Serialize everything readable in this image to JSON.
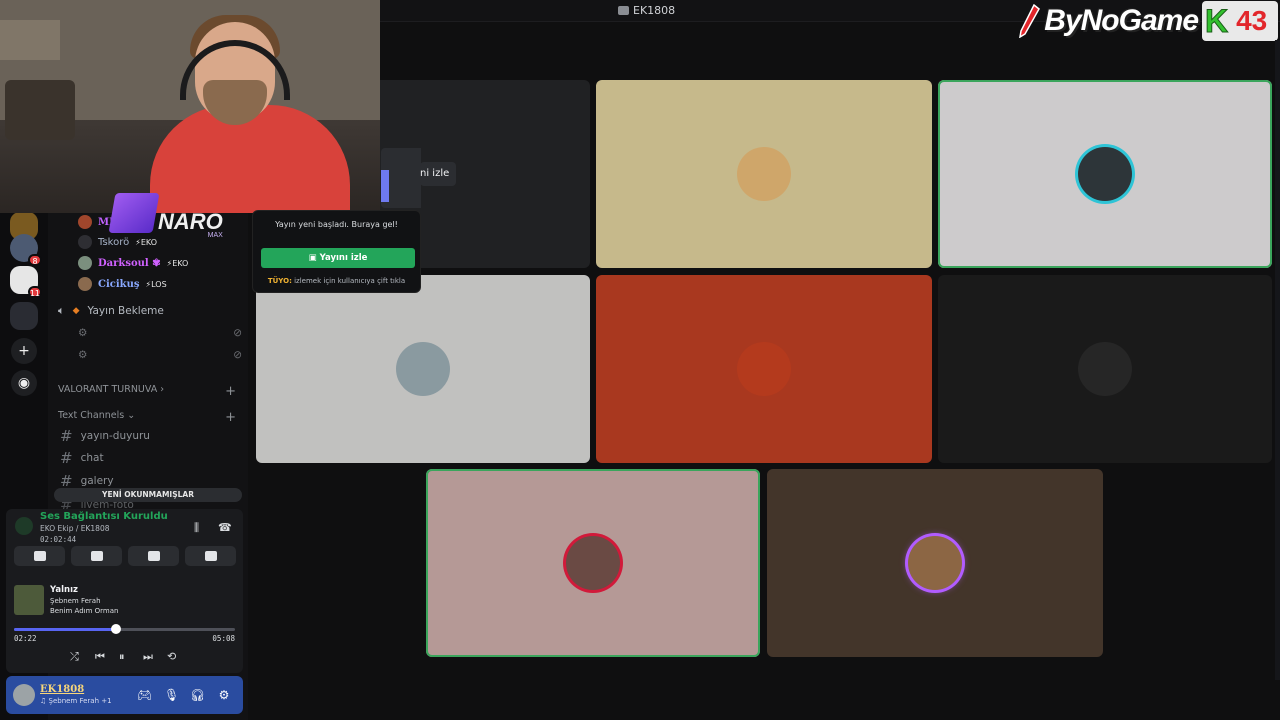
{
  "window": {
    "title": "EK1808"
  },
  "logo": {
    "brand": "ByNoGame",
    "k_letter": "K",
    "number": "43"
  },
  "watermark": {
    "text": "NARO",
    "sub": "MAX"
  },
  "rail": {
    "badges": [
      "8",
      "11"
    ]
  },
  "sidebar": {
    "members": [
      {
        "name": "MIN",
        "tag": "",
        "color": "#c061ff"
      },
      {
        "name": "Tskorö",
        "tag": "⚡EKO",
        "color": "#a7b3c8"
      },
      {
        "name": "Darksoul ✾",
        "tag": "⚡EKO",
        "color": "#d061ff"
      },
      {
        "name": "Cicikuş",
        "tag": "⚡LOS",
        "color": "#89a8ff"
      }
    ],
    "voice_channel": "Yayın Bekleme",
    "category_valorant": "VALORANT TURNUVA",
    "category_text": "Text Channels",
    "text_channels": [
      "yayın-duyuru",
      "chat",
      "galery",
      "livem-foto"
    ],
    "unread_banner": "YENİ OKUNMAMIŞLAR"
  },
  "voice_panel": {
    "status": "Ses Bağlantısı Kuruldu",
    "channel": "EKO Ekip / EK1808",
    "elapsed": "02:02:44"
  },
  "now_playing": {
    "title": "Yalnız",
    "artist": "Şebnem Ferah",
    "album": "Benim Adım Orman",
    "current_time": "02:22",
    "duration": "05:08",
    "progress": 0.46
  },
  "user": {
    "name": "EK1808",
    "status": "♫ Şebnem Ferah +1"
  },
  "popup": {
    "message": "Yayın yeni başladı. Buraya gel!",
    "button": "Yayını izle",
    "tip_label": "TÜYO:",
    "tip_text": "izlemek için kullanıcıya çift tıkla"
  },
  "watch_chip": "ni izle",
  "tiles": [
    {
      "name": "tile-stream",
      "color": "#202123",
      "speaking": false
    },
    {
      "name": "tile-cat",
      "color": "#c6b98b",
      "speaking": false,
      "avatar": "#cfa66a"
    },
    {
      "name": "tile-user-teal",
      "color": "#cdcbcc",
      "speaking": true,
      "avatar": "#2d3539"
    },
    {
      "name": "tile-user-beach",
      "color": "#c1c1bf",
      "speaking": false,
      "avatar": "#8a9aa0"
    },
    {
      "name": "tile-planet",
      "color": "#a9381f",
      "speaking": false,
      "avatar": "#b43a1d"
    },
    {
      "name": "tile-dark",
      "color": "#1a1a1a",
      "speaking": false,
      "avatar": "#262626"
    },
    {
      "name": "tile-woman",
      "color": "#b59996",
      "speaking": true,
      "avatar": "#6a4a44"
    },
    {
      "name": "tile-brown",
      "color": "#43352a",
      "speaking": false,
      "avatar": "#8c6644"
    }
  ]
}
